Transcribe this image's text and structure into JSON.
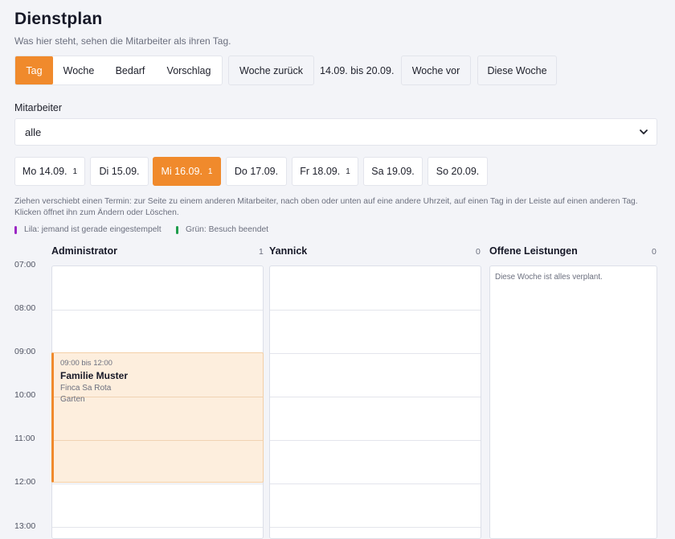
{
  "header": {
    "title": "Dienstplan",
    "subtitle": "Was hier steht, sehen die Mitarbeiter als ihren Tag."
  },
  "views": [
    "Tag",
    "Woche",
    "Bedarf",
    "Vorschlag"
  ],
  "active_view": "Tag",
  "nav": {
    "prev_label": "Woche zurück",
    "range": "14.09. bis 20.09.",
    "next_label": "Woche vor",
    "this_week_label": "Diese Woche"
  },
  "employee_filter": {
    "label": "Mitarbeiter",
    "selected": "alle"
  },
  "days": [
    {
      "label": "Mo 14.09.",
      "count": "1"
    },
    {
      "label": "Di 15.09.",
      "count": ""
    },
    {
      "label": "Mi 16.09.",
      "count": "1",
      "active": true
    },
    {
      "label": "Do 17.09.",
      "count": ""
    },
    {
      "label": "Fr 18.09.",
      "count": "1"
    },
    {
      "label": "Sa 19.09.",
      "count": ""
    },
    {
      "label": "So 20.09.",
      "count": ""
    }
  ],
  "hint": "Ziehen verschiebt einen Termin: zur Seite zu einem anderen Mitarbeiter, nach oben oder unten auf eine andere Uhrzeit, auf einen Tag in der Leiste auf einen anderen Tag. Klicken öffnet ihn zum Ändern oder Löschen.",
  "legend": [
    {
      "label": "Lila: jemand ist gerade eingestempelt",
      "color": "#9b27c4"
    },
    {
      "label": "Grün: Besuch beendet",
      "color": "#1f9d4c"
    }
  ],
  "times": [
    "07:00",
    "08:00",
    "09:00",
    "10:00",
    "11:00",
    "12:00",
    "13:00"
  ],
  "columns": [
    {
      "name": "Administrator",
      "count": "1"
    },
    {
      "name": "Yannick",
      "count": "0"
    },
    {
      "name": "Offene Leistungen",
      "count": "0"
    }
  ],
  "open_services_message": "Diese Woche ist alles verplant.",
  "event": {
    "time": "09:00 bis 12:00",
    "title": "Familie Muster",
    "line1": "Finca Sa Rota",
    "line2": "Garten"
  },
  "colors": {
    "accent": "#f08a2c",
    "event_bg": "#fdeedd"
  }
}
